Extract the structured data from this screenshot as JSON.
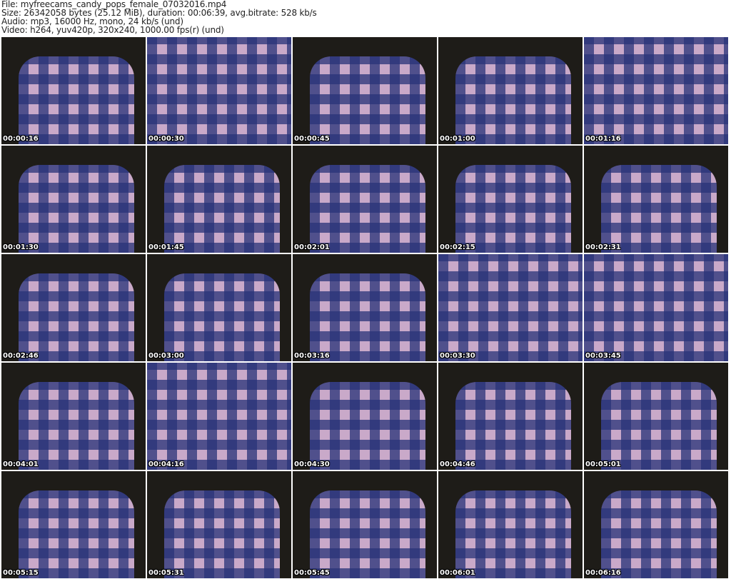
{
  "info": {
    "file": "File: myfreecams_candy_pops_female_07032016.mp4",
    "size": "Size: 26342058 bytes (25.12 MiB), duration: 00:06:39, avg.bitrate: 528 kb/s",
    "audio": "Audio: mp3, 16000 Hz, mono, 24 kb/s (und)",
    "video": "Video: h264, yuv420p, 320x240, 1000.00 fps(r) (und)"
  },
  "thumbnails": [
    "00:00:16",
    "00:00:30",
    "00:00:45",
    "00:01:00",
    "00:01:16",
    "00:01:30",
    "00:01:45",
    "00:02:01",
    "00:02:15",
    "00:02:31",
    "00:02:46",
    "00:03:00",
    "00:03:16",
    "00:03:30",
    "00:03:45",
    "00:04:01",
    "00:04:16",
    "00:04:30",
    "00:04:46",
    "00:05:01",
    "00:05:15",
    "00:05:31",
    "00:05:45",
    "00:06:01",
    "00:06:16"
  ]
}
